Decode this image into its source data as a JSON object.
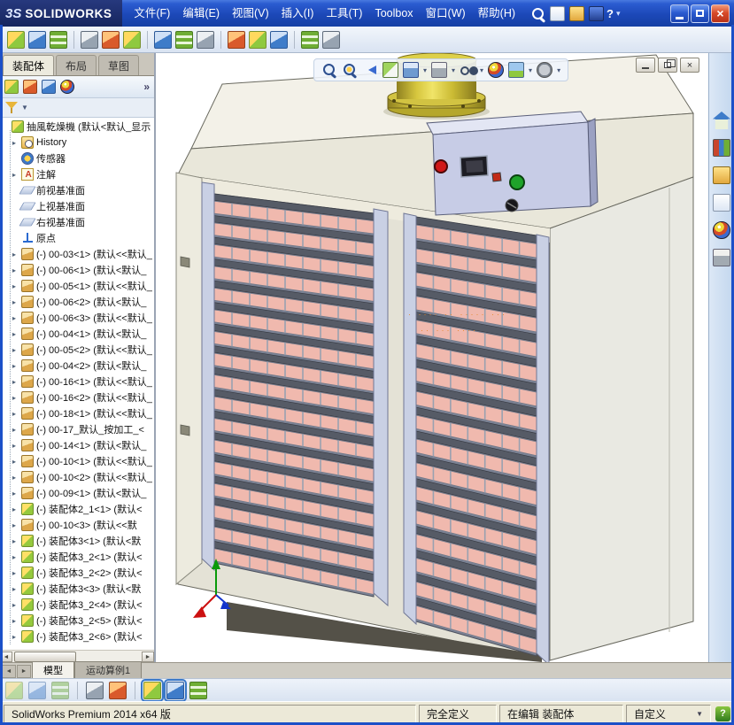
{
  "window": {
    "logo_mark": "3S",
    "brand": "SOLIDWORKS",
    "menu": [
      "文件(F)",
      "编辑(E)",
      "视图(V)",
      "插入(I)",
      "工具(T)",
      "Toolbox",
      "窗口(W)",
      "帮助(H)"
    ],
    "quick_icons": [
      "search-icon",
      "new-document-icon",
      "open-icon",
      "save-icon"
    ],
    "help_label": "?",
    "control_icons": [
      "minimize-icon",
      "maximize-icon",
      "close-icon"
    ]
  },
  "toolbar_assembly": {
    "icons": [
      "insert-component-icon",
      "mate-icon",
      "linear-component-pattern-icon",
      "smart-fasteners-icon",
      "move-component-icon",
      "rotate-component-icon",
      "show-hidden-components-icon",
      "assembly-features-icon",
      "reference-geometry-icon",
      "new-motion-study-icon",
      "bill-of-materials-icon",
      "exploded-view-icon",
      "instant3d-icon",
      "external-references-icon"
    ]
  },
  "command_tabs": {
    "items": [
      "装配体",
      "布局",
      "草图"
    ],
    "active_index": 0
  },
  "feature_panel": {
    "manager_icons": [
      "featuremanager-tree-icon",
      "propertymanager-icon",
      "configurationmanager-icon",
      "displaymanager-icon"
    ],
    "expand_chevron": "»",
    "filter_icon": "filter-funnel-icon",
    "tree_items": [
      {
        "icon": "assembly",
        "arrow": false,
        "label": "抽風乾燥機 (默认<默认_显示"
      },
      {
        "icon": "history",
        "arrow": true,
        "label": "History"
      },
      {
        "icon": "sensor",
        "arrow": false,
        "label": "传感器"
      },
      {
        "icon": "annotation",
        "arrow": true,
        "label": "注解"
      },
      {
        "icon": "plane",
        "arrow": false,
        "label": "前视基准面"
      },
      {
        "icon": "plane",
        "arrow": false,
        "label": "上视基准面"
      },
      {
        "icon": "plane",
        "arrow": false,
        "label": "右视基准面"
      },
      {
        "icon": "origin",
        "arrow": false,
        "label": "原点"
      },
      {
        "icon": "part",
        "arrow": true,
        "label": "(-) 00-03<1> (默认<<默认_"
      },
      {
        "icon": "part",
        "arrow": true,
        "label": "(-) 00-06<1> (默认<默认_"
      },
      {
        "icon": "part",
        "arrow": true,
        "label": "(-) 00-05<1> (默认<<默认_"
      },
      {
        "icon": "part",
        "arrow": true,
        "label": "(-) 00-06<2> (默认<默认_"
      },
      {
        "icon": "part",
        "arrow": true,
        "label": "(-) 00-06<3> (默认<<默认_"
      },
      {
        "icon": "part",
        "arrow": true,
        "label": "(-) 00-04<1> (默认<默认_"
      },
      {
        "icon": "part",
        "arrow": true,
        "label": "(-) 00-05<2> (默认<<默认_"
      },
      {
        "icon": "part",
        "arrow": true,
        "label": "(-) 00-04<2> (默认<默认_"
      },
      {
        "icon": "part",
        "arrow": true,
        "label": "(-) 00-16<1> (默认<<默认_"
      },
      {
        "icon": "part",
        "arrow": true,
        "label": "(-) 00-16<2> (默认<<默认_"
      },
      {
        "icon": "part",
        "arrow": true,
        "label": "(-) 00-18<1> (默认<<默认_"
      },
      {
        "icon": "part",
        "arrow": true,
        "label": "(-) 00-17_默认_按加工_<"
      },
      {
        "icon": "part",
        "arrow": true,
        "label": "(-) 00-14<1> (默认<默认_"
      },
      {
        "icon": "part",
        "arrow": true,
        "label": "(-) 00-10<1> (默认<<默认_"
      },
      {
        "icon": "part",
        "arrow": true,
        "label": "(-) 00-10<2> (默认<<默认_"
      },
      {
        "icon": "part",
        "arrow": true,
        "label": "(-) 00-09<1> (默认<默认_"
      },
      {
        "icon": "subassembly",
        "arrow": true,
        "label": "(-) 装配体2_1<1> (默认<"
      },
      {
        "icon": "part",
        "arrow": true,
        "label": "(-) 00-10<3> (默认<<默"
      },
      {
        "icon": "subassembly",
        "arrow": true,
        "label": "(-) 装配体3<1> (默认<默"
      },
      {
        "icon": "subassembly",
        "arrow": true,
        "label": "(-) 装配体3_2<1> (默认<"
      },
      {
        "icon": "subassembly",
        "arrow": true,
        "label": "(-) 装配体3_2<2> (默认<"
      },
      {
        "icon": "subassembly",
        "arrow": true,
        "label": "(-) 装配体3<3> (默认<默"
      },
      {
        "icon": "subassembly",
        "arrow": true,
        "label": "(-) 装配体3_2<4> (默认<"
      },
      {
        "icon": "subassembly",
        "arrow": true,
        "label": "(-) 装配体3_2<5> (默认<"
      },
      {
        "icon": "subassembly",
        "arrow": true,
        "label": "(-) 装配体3_2<6> (默认<"
      }
    ]
  },
  "viewport": {
    "heads_up_icons": [
      "zoom-fit-icon",
      "zoom-area-icon",
      "previous-view-icon",
      "section-view-icon",
      "view-orientation-icon",
      "display-style-icon",
      "hide-show-items-icon",
      "edit-appearance-icon",
      "apply-scene-icon",
      "view-settings-icon"
    ],
    "child_window_icons": [
      "document-minimize-icon",
      "document-restore-icon",
      "document-close-icon"
    ],
    "watermark_lines": [
      "· ···· ·· ····· ···",
      "·· ··· ····"
    ]
  },
  "task_pane": {
    "icons": [
      "solidworks-resources-icon",
      "design-library-icon",
      "file-explorer-icon",
      "view-palette-icon",
      "appearances-scenes-icon",
      "custom-properties-icon"
    ]
  },
  "model_tabs": {
    "items": [
      "模型",
      "运动算例1"
    ],
    "active_index": 0
  },
  "toolbar_bottom": {
    "icons": [
      "selection-filter-icon",
      "filter-faces-icon",
      "filter-edges-icon",
      "isolate-icon",
      "edit-component-icon",
      "assembly-transparency-icon",
      "display-pane-icon",
      "grid-display-icon"
    ]
  },
  "statusbar": {
    "app_version": "SolidWorks Premium 2014 x64 版",
    "definition_state": "完全定义",
    "editing_state": "在编辑 装配体",
    "custom_menu": "自定义",
    "help_icon": "help-icon"
  }
}
